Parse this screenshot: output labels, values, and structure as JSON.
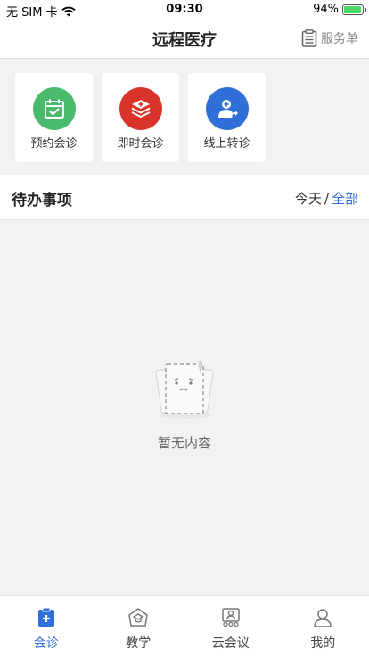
{
  "status_bar": {
    "carrier": "无 SIM 卡",
    "time": "09:30",
    "battery": "94%",
    "battery_level": 0.94
  },
  "nav": {
    "title": "远程医疗",
    "action_label": "服务单",
    "action_icon": "clipboard-icon"
  },
  "quick_actions": [
    {
      "label": "预约会诊",
      "icon": "calendar-check-icon",
      "color": "#4cba6c"
    },
    {
      "label": "即时会诊",
      "icon": "first-aid-layers-icon",
      "color": "#d8342c"
    },
    {
      "label": "线上转诊",
      "icon": "doctor-referral-icon",
      "color": "#2f6fd8"
    }
  ],
  "todo": {
    "title": "待办事项",
    "filter_today": "今天",
    "filter_separator": "/",
    "filter_all": "全部"
  },
  "empty": {
    "text": "暂无内容",
    "icon": "empty-paper-icon"
  },
  "tabs": [
    {
      "label": "会诊",
      "icon": "consult-icon",
      "active": true
    },
    {
      "label": "教学",
      "icon": "teaching-icon",
      "active": false
    },
    {
      "label": "云会议",
      "icon": "meeting-icon",
      "active": false
    },
    {
      "label": "我的",
      "icon": "profile-icon",
      "active": false
    }
  ],
  "colors": {
    "accent": "#2f6fd8",
    "background": "#f2f2f2"
  }
}
